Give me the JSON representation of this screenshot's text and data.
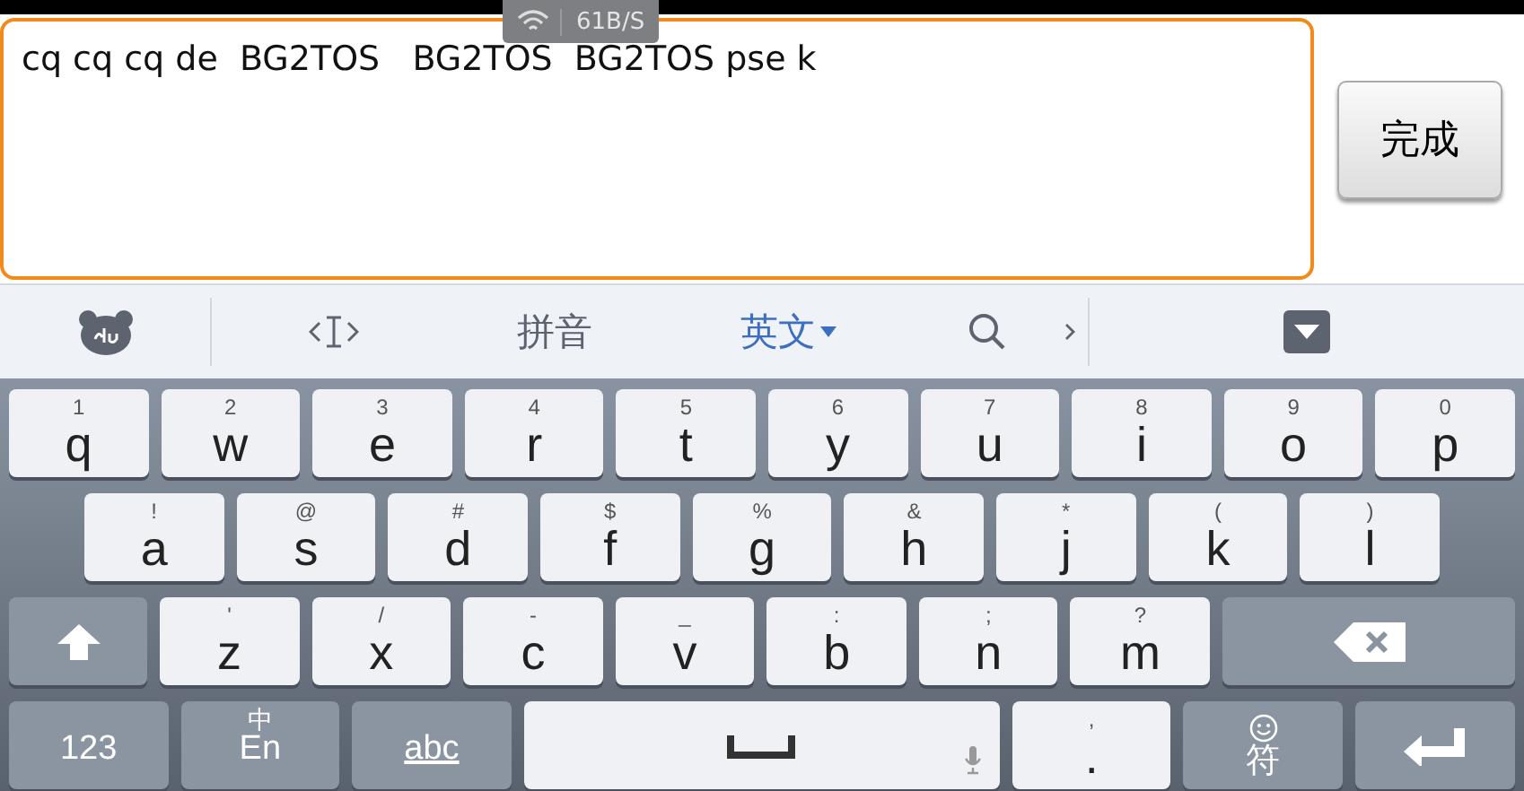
{
  "status_overlay": {
    "speed": "61B/S"
  },
  "text_field": {
    "value": "cq cq cq de  BG2TOS   BG2TOS  BG2TOS pse k"
  },
  "done_button": {
    "label": "完成"
  },
  "toolbar": {
    "tabs": [
      {
        "label": "拼音",
        "selected": false
      },
      {
        "label": "英文",
        "selected": true
      }
    ]
  },
  "keyboard": {
    "rows": [
      [
        {
          "kind": "letter",
          "label": "q",
          "hint": "1"
        },
        {
          "kind": "letter",
          "label": "w",
          "hint": "2"
        },
        {
          "kind": "letter",
          "label": "e",
          "hint": "3"
        },
        {
          "kind": "letter",
          "label": "r",
          "hint": "4"
        },
        {
          "kind": "letter",
          "label": "t",
          "hint": "5"
        },
        {
          "kind": "letter",
          "label": "y",
          "hint": "6"
        },
        {
          "kind": "letter",
          "label": "u",
          "hint": "7"
        },
        {
          "kind": "letter",
          "label": "i",
          "hint": "8"
        },
        {
          "kind": "letter",
          "label": "o",
          "hint": "9"
        },
        {
          "kind": "letter",
          "label": "p",
          "hint": "0"
        }
      ],
      [
        {
          "kind": "letter",
          "label": "a",
          "hint": "!"
        },
        {
          "kind": "letter",
          "label": "s",
          "hint": "@"
        },
        {
          "kind": "letter",
          "label": "d",
          "hint": "#"
        },
        {
          "kind": "letter",
          "label": "f",
          "hint": "$"
        },
        {
          "kind": "letter",
          "label": "g",
          "hint": "%"
        },
        {
          "kind": "letter",
          "label": "h",
          "hint": "&"
        },
        {
          "kind": "letter",
          "label": "j",
          "hint": "*"
        },
        {
          "kind": "letter",
          "label": "k",
          "hint": "("
        },
        {
          "kind": "letter",
          "label": "l",
          "hint": ")"
        }
      ],
      [
        {
          "kind": "shift"
        },
        {
          "kind": "letter",
          "label": "z",
          "hint": "'"
        },
        {
          "kind": "letter",
          "label": "x",
          "hint": "/"
        },
        {
          "kind": "letter",
          "label": "c",
          "hint": "-"
        },
        {
          "kind": "letter",
          "label": "v",
          "hint": "_"
        },
        {
          "kind": "letter",
          "label": "b",
          "hint": ":"
        },
        {
          "kind": "letter",
          "label": "n",
          "hint": ";"
        },
        {
          "kind": "letter",
          "label": "m",
          "hint": "?"
        },
        {
          "kind": "backspace"
        }
      ],
      [
        {
          "kind": "function",
          "label": "123"
        },
        {
          "kind": "function",
          "label": "En",
          "hint": "中"
        },
        {
          "kind": "abc",
          "label": "abc"
        },
        {
          "kind": "space"
        },
        {
          "kind": "letter",
          "label": ".",
          "hint": ","
        },
        {
          "kind": "symbols",
          "label": "符"
        },
        {
          "kind": "enter"
        }
      ]
    ]
  }
}
